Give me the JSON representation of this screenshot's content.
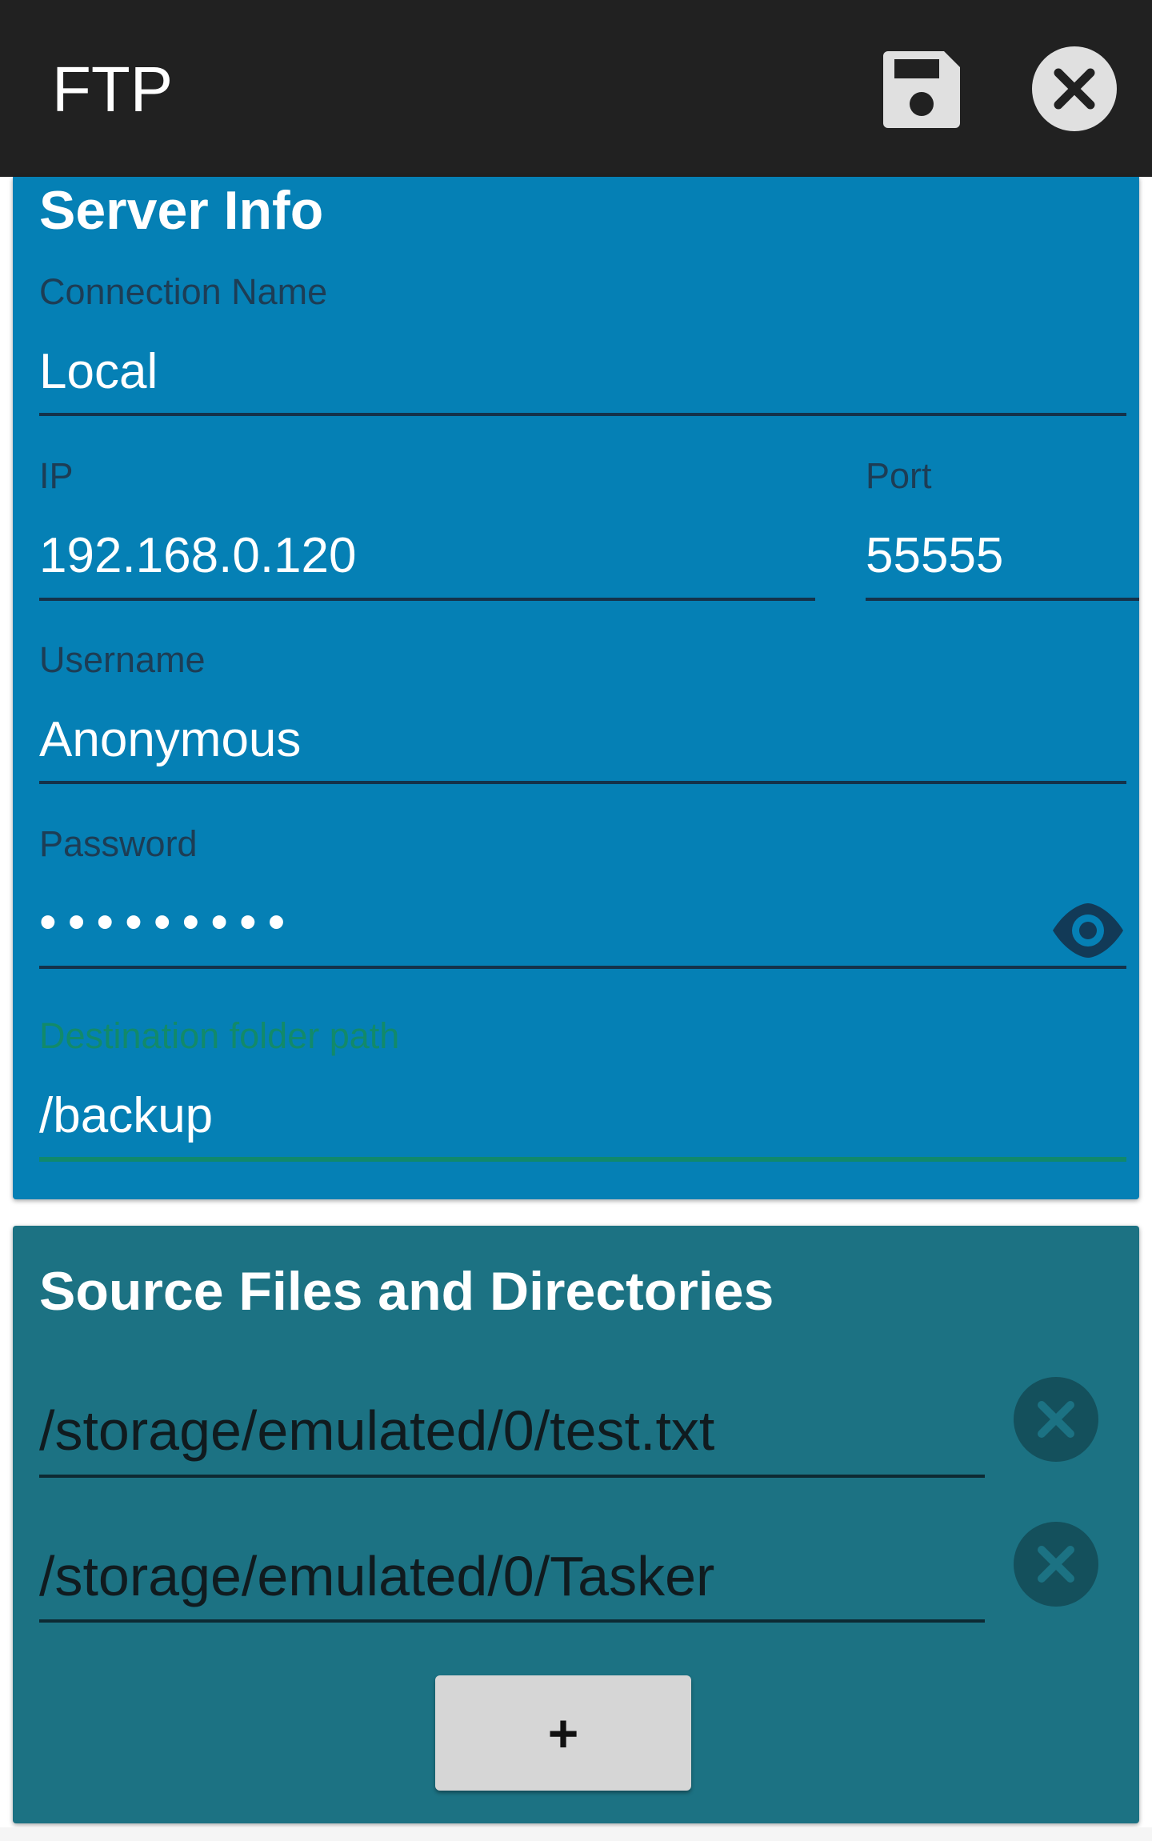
{
  "app_bar": {
    "title": "FTP",
    "save_icon": "save-icon",
    "close_icon": "close-icon"
  },
  "server_info": {
    "title": "Server Info",
    "connection_name": {
      "label": "Connection Name",
      "value": "Local"
    },
    "ip": {
      "label": "IP",
      "value": "192.168.0.120"
    },
    "port": {
      "label": "Port",
      "value": "55555"
    },
    "username": {
      "label": "Username",
      "value": "Anonymous"
    },
    "password": {
      "label": "Password",
      "value": "•••••••••",
      "toggle_icon": "eye-icon"
    },
    "destination": {
      "label": "Destination folder path",
      "value": "/backup"
    }
  },
  "source": {
    "title": "Source Files and Directories",
    "items": [
      {
        "path": "/storage/emulated/0/test.txt"
      },
      {
        "path": "/storage/emulated/0/Tasker"
      }
    ],
    "add_label": "+"
  },
  "colors": {
    "app_bar": "#212121",
    "server_card": "#0580b5",
    "source_card": "#1c7283",
    "accent": "#10896c"
  }
}
